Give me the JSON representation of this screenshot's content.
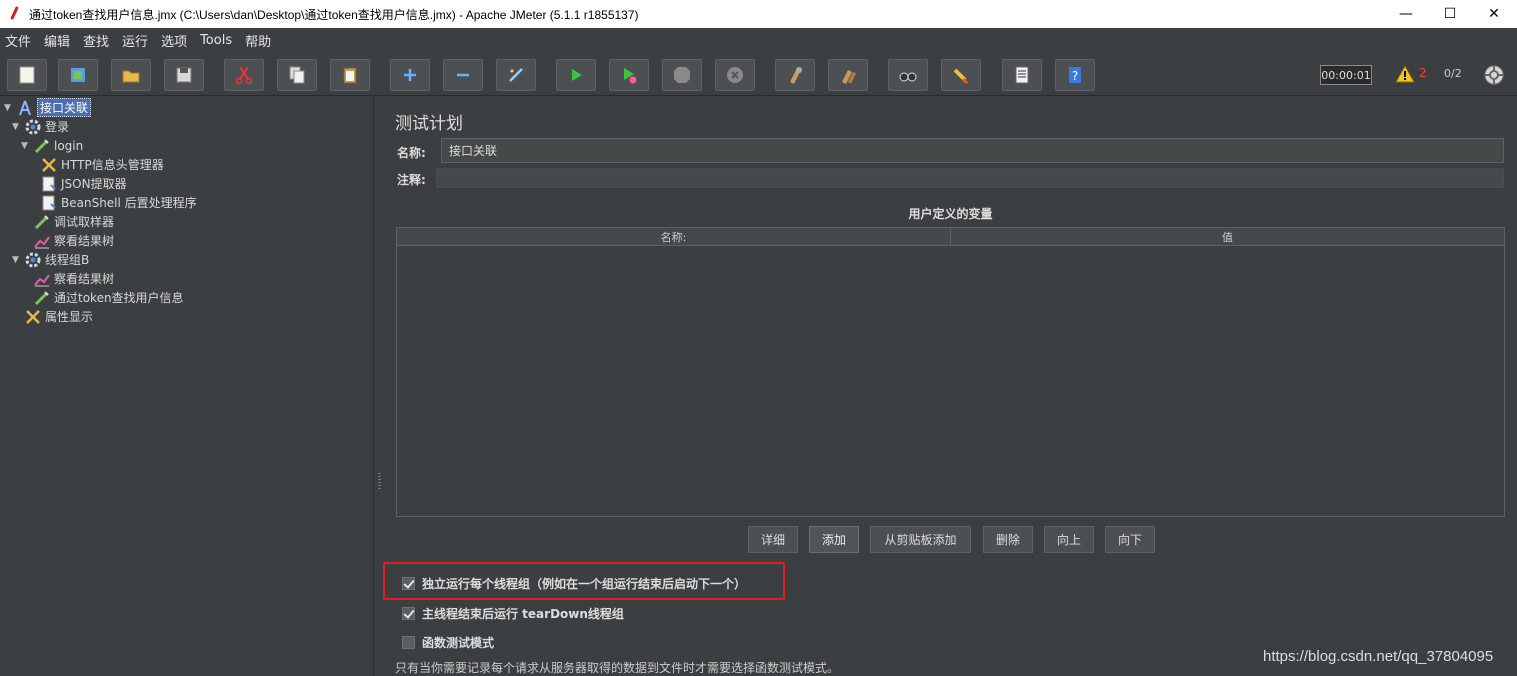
{
  "window": {
    "title": "通过token查找用户信息.jmx (C:\\Users\\dan\\Desktop\\通过token查找用户信息.jmx) - Apache JMeter (5.1.1 r1855137)",
    "minimize": "—",
    "maximize": "☐",
    "close": "✕"
  },
  "menu": [
    "文件",
    "编辑",
    "查找",
    "运行",
    "选项",
    "Tools",
    "帮助"
  ],
  "toolbar": {
    "timer": "00:00:01",
    "warning_count": "2",
    "threads": "0/2"
  },
  "tree": {
    "root": "接口关联",
    "group1": "登录",
    "sampler1": "login",
    "header_mgr": "HTTP信息头管理器",
    "json_extractor": "JSON提取器",
    "beanshell": "BeanShell 后置处理程序",
    "debug_sampler": "调试取样器",
    "result_tree1": "察看结果树",
    "group2": "线程组B",
    "result_tree2": "察看结果树",
    "sampler2": "通过token查找用户信息",
    "property_display": "属性显示"
  },
  "panel": {
    "title": "测试计划",
    "name_label": "名称:",
    "name_value": "接口关联",
    "comment_label": "注释:",
    "comment_value": "",
    "vars_title": "用户定义的变量",
    "col_name": "名称:",
    "col_value": "值",
    "buttons": {
      "detail": "详细",
      "add": "添加",
      "add_clipboard": "从剪贴板添加",
      "delete": "删除",
      "up": "向上",
      "down": "向下"
    },
    "opt_serialize": "独立运行每个线程组（例如在一个组运行结束后启动下一个）",
    "opt_teardown": "主线程结束后运行 tearDown线程组",
    "opt_functional": "函数测试模式",
    "hint": "只有当你需要记录每个请求从服务器取得的数据到文件时才需要选择函数测试模式。"
  },
  "watermark": "https://blog.csdn.net/qq_37804095",
  "colors": {
    "background": "#3c3f41",
    "selection": "#4b6eaf",
    "highlight_box": "#e02020"
  }
}
